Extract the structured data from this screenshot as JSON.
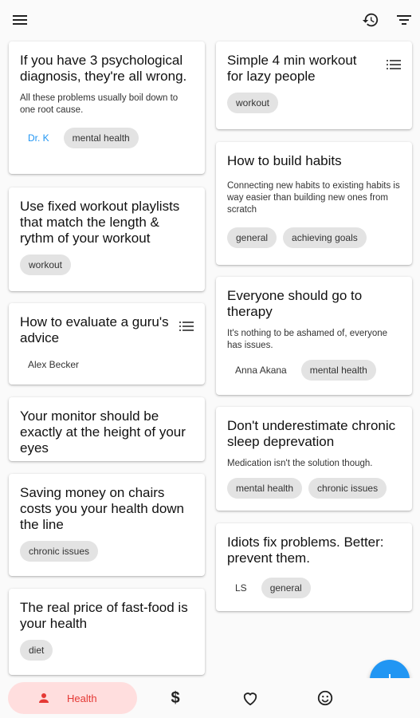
{
  "toolbar": {
    "menu_icon": "hamburger-menu-icon",
    "history_icon": "history-icon",
    "filter_icon": "filter-icon"
  },
  "left_cards": [
    {
      "title": "If you have 3 psychological diagnosis, they're all wrong.",
      "desc": "All these problems usually boil down to one root cause.",
      "author": "Dr. K",
      "tags": [
        "mental health"
      ]
    },
    {
      "title": "Use fixed workout playlists that match the length & rythm of your workout",
      "tags": [
        "workout"
      ]
    },
    {
      "title": "How to evaluate a guru's advice",
      "author": "Alex Becker",
      "list_icon": "list-icon"
    },
    {
      "title": "Your monitor should be exactly at the height of your eyes"
    },
    {
      "title": "Saving money on chairs costs you your health down the line",
      "tags": [
        "chronic issues"
      ]
    },
    {
      "title": "The real price of fast-food is your health",
      "tags": [
        "diet"
      ]
    }
  ],
  "right_cards": [
    {
      "title": "Simple 4 min workout for lazy people",
      "tags": [
        "workout"
      ],
      "list_icon": "list-icon"
    },
    {
      "title": "How to build habits",
      "desc": "Connecting new habits to existing habits is way easier than building new ones from scratch",
      "tags": [
        "general",
        "achieving goals"
      ]
    },
    {
      "title": "Everyone should go to therapy",
      "desc": "It's nothing to be ashamed of, everyone has issues.",
      "author": "Anna Akana",
      "tags": [
        "mental health"
      ]
    },
    {
      "title": "Don't underestimate chronic sleep deprevation",
      "desc": "Medication isn't the solution though.",
      "tags": [
        "mental health",
        "chronic issues"
      ]
    },
    {
      "title": "Idiots fix problems. Better: prevent them.",
      "author": "LS",
      "tags": [
        "general"
      ]
    }
  ],
  "bottom_nav": {
    "items": [
      {
        "label": "Health",
        "icon": "person-icon",
        "active": true
      },
      {
        "label": "",
        "icon": "dollar-icon"
      },
      {
        "label": "",
        "icon": "heart-icon"
      },
      {
        "label": "",
        "icon": "smiley-icon"
      }
    ]
  },
  "fab": {
    "icon": "plus-icon"
  },
  "colors": {
    "accent": "#2196f3",
    "active_nav_bg": "#ffdede",
    "active_nav_fg": "#e53935",
    "chip_bg": "#e3e3e3"
  }
}
